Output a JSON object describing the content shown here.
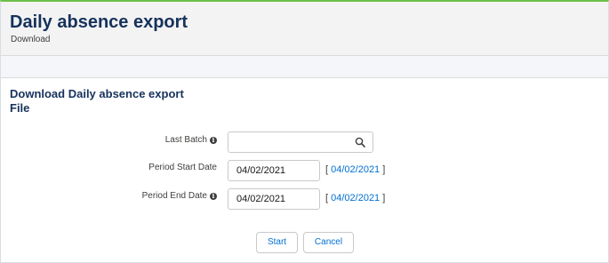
{
  "header": {
    "title": "Daily absence export",
    "subtitle": "Download"
  },
  "section": {
    "title": "Download Daily absence export File"
  },
  "fields": {
    "last_batch": {
      "label": "Last Batch",
      "value": "",
      "has_info": true
    },
    "period_start": {
      "label": "Period Start Date",
      "value": "04/02/2021",
      "link": "04/02/2021"
    },
    "period_end": {
      "label": "Period End Date",
      "value": "04/02/2021",
      "link": "04/02/2021",
      "has_info": true
    }
  },
  "bracket": {
    "open": "[ ",
    "close": " ]"
  },
  "buttons": {
    "start": "Start",
    "cancel": "Cancel"
  },
  "icons": {
    "search": "search-icon",
    "info": "info-icon"
  },
  "colors": {
    "accent_top": "#6cc04a",
    "title": "#16325c",
    "link": "#0070d2"
  }
}
